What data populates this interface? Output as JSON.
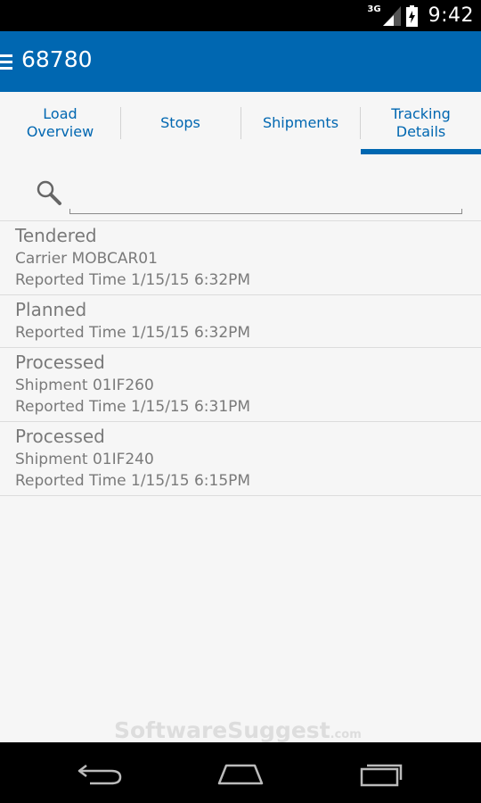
{
  "status_bar": {
    "network_type": "3G",
    "time": "9:42",
    "icons": [
      "signal-icon",
      "battery-icon"
    ]
  },
  "app_bar": {
    "title": "68780",
    "icon": "menu-icon",
    "color": "#0067b1"
  },
  "tabs": [
    {
      "label": "Load\nOverview",
      "active": false
    },
    {
      "label": "Stops",
      "active": false
    },
    {
      "label": "Shipments",
      "active": false
    },
    {
      "label": "Tracking\nDetails",
      "active": true
    }
  ],
  "search": {
    "icon": "search-icon",
    "value": "",
    "placeholder": ""
  },
  "tracking_items": [
    {
      "status": "Tendered",
      "lines": [
        "Carrier MOBCAR01",
        "Reported Time 1/15/15 6:32PM"
      ]
    },
    {
      "status": "Planned",
      "lines": [
        "Reported Time 1/15/15 6:32PM"
      ]
    },
    {
      "status": "Processed",
      "lines": [
        "Shipment 01IF260",
        "Reported Time 1/15/15 6:31PM"
      ]
    },
    {
      "status": "Processed",
      "lines": [
        "Shipment 01IF240",
        "Reported Time 1/15/15 6:15PM"
      ]
    }
  ],
  "watermark": {
    "text": "SoftwareSuggest",
    "suffix": ".com"
  },
  "nav_bar": {
    "icons": [
      "back-icon",
      "home-icon",
      "recent-apps-icon"
    ]
  }
}
